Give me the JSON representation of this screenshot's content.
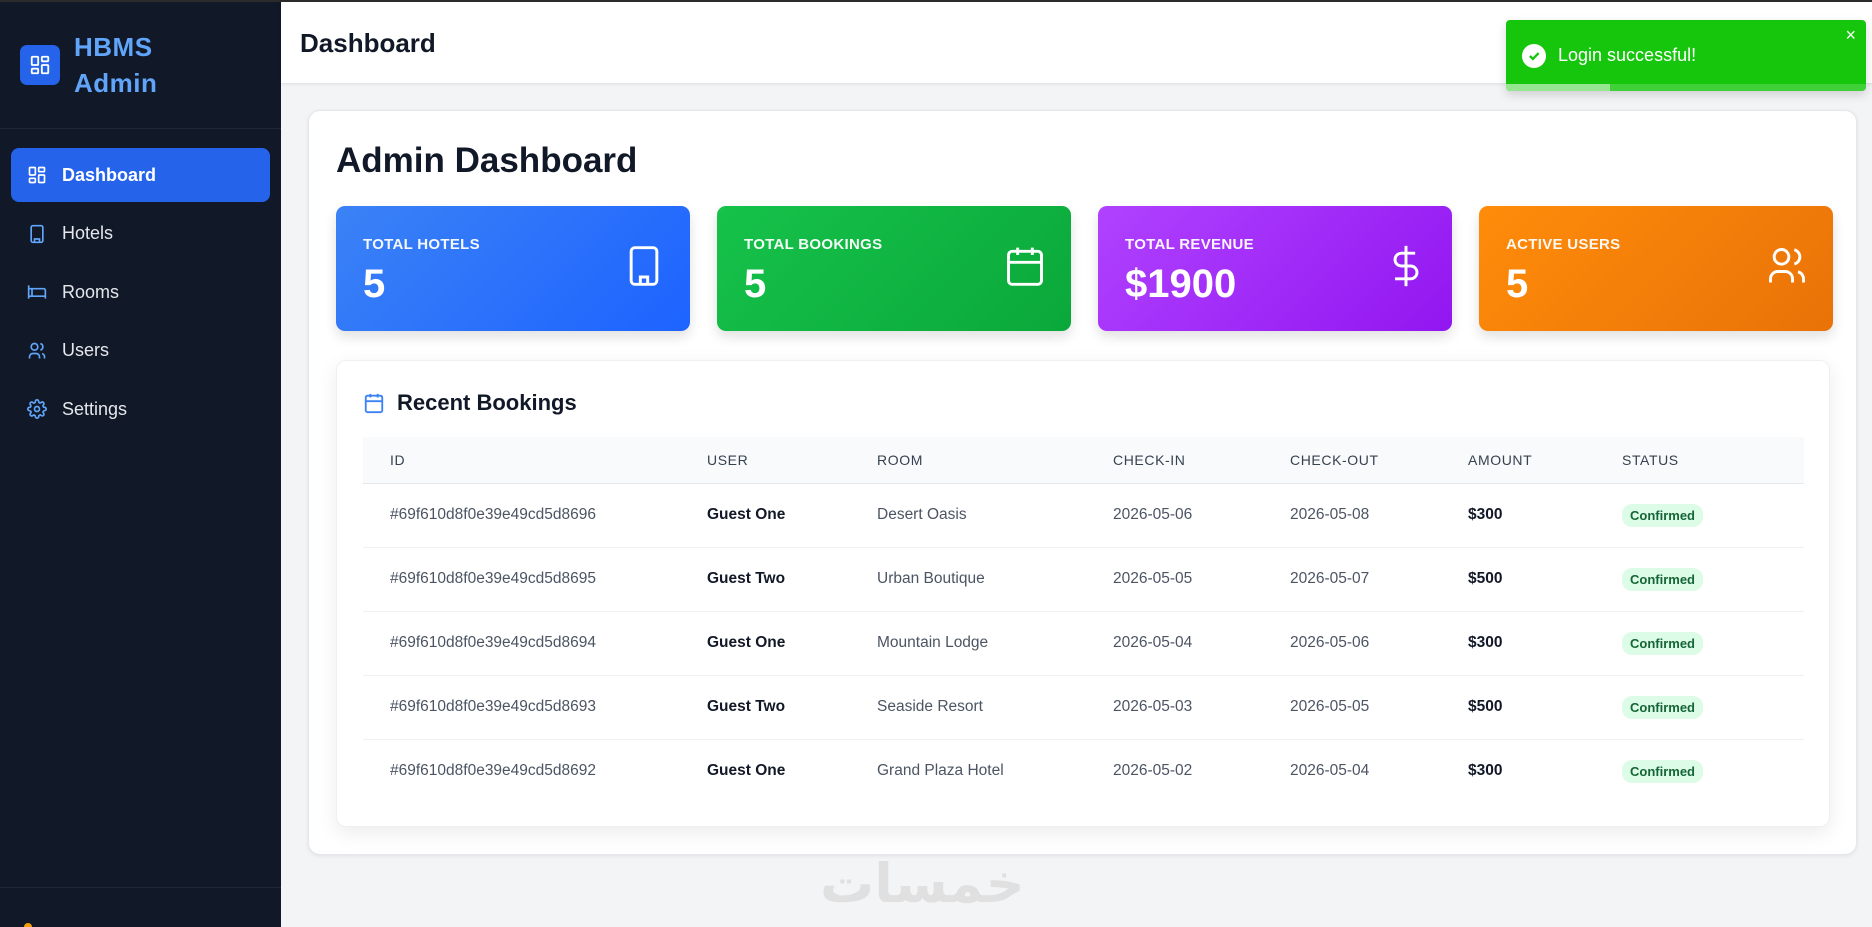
{
  "app": {
    "brand_title": "HBMS Admin",
    "accent_color": "#2563eb"
  },
  "sidebar": {
    "items": [
      {
        "label": "Dashboard",
        "icon": "dashboard-grid-icon",
        "active": true
      },
      {
        "label": "Hotels",
        "icon": "building-icon",
        "active": false
      },
      {
        "label": "Rooms",
        "icon": "bed-icon",
        "active": false
      },
      {
        "label": "Users",
        "icon": "users-icon",
        "active": false
      },
      {
        "label": "Settings",
        "icon": "gear-icon",
        "active": false
      }
    ]
  },
  "header": {
    "title": "Dashboard"
  },
  "toast": {
    "message": "Login successful!",
    "close_label": "×",
    "progress": 0.29,
    "color": "#16c60c"
  },
  "main": {
    "title": "Admin Dashboard",
    "stats": [
      {
        "label": "TOTAL HOTELS",
        "value": "5",
        "icon": "building-icon",
        "color": "#2563eb"
      },
      {
        "label": "TOTAL BOOKINGS",
        "value": "5",
        "icon": "calendar-icon",
        "color": "#16c24a"
      },
      {
        "label": "TOTAL REVENUE",
        "value": "$1900",
        "icon": "dollar-icon",
        "color": "#9333ea"
      },
      {
        "label": "ACTIVE USERS",
        "value": "5",
        "icon": "users-icon",
        "color": "#f97316"
      }
    ],
    "recent_bookings": {
      "title": "Recent Bookings",
      "columns": [
        "ID",
        "USER",
        "ROOM",
        "CHECK-IN",
        "CHECK-OUT",
        "AMOUNT",
        "STATUS"
      ],
      "rows": [
        {
          "id": "#69f610d8f0e39e49cd5d8696",
          "user": "Guest One",
          "room": "Desert Oasis",
          "check_in": "2026-05-06",
          "check_out": "2026-05-08",
          "amount": "$300",
          "status": "Confirmed"
        },
        {
          "id": "#69f610d8f0e39e49cd5d8695",
          "user": "Guest Two",
          "room": "Urban Boutique",
          "check_in": "2026-05-05",
          "check_out": "2026-05-07",
          "amount": "$500",
          "status": "Confirmed"
        },
        {
          "id": "#69f610d8f0e39e49cd5d8694",
          "user": "Guest One",
          "room": "Mountain Lodge",
          "check_in": "2026-05-04",
          "check_out": "2026-05-06",
          "amount": "$300",
          "status": "Confirmed"
        },
        {
          "id": "#69f610d8f0e39e49cd5d8693",
          "user": "Guest Two",
          "room": "Seaside Resort",
          "check_in": "2026-05-03",
          "check_out": "2026-05-05",
          "amount": "$500",
          "status": "Confirmed"
        },
        {
          "id": "#69f610d8f0e39e49cd5d8692",
          "user": "Guest One",
          "room": "Grand Plaza Hotel",
          "check_in": "2026-05-02",
          "check_out": "2026-05-04",
          "amount": "$300",
          "status": "Confirmed"
        }
      ]
    }
  },
  "watermark": {
    "text": "خمسات"
  }
}
